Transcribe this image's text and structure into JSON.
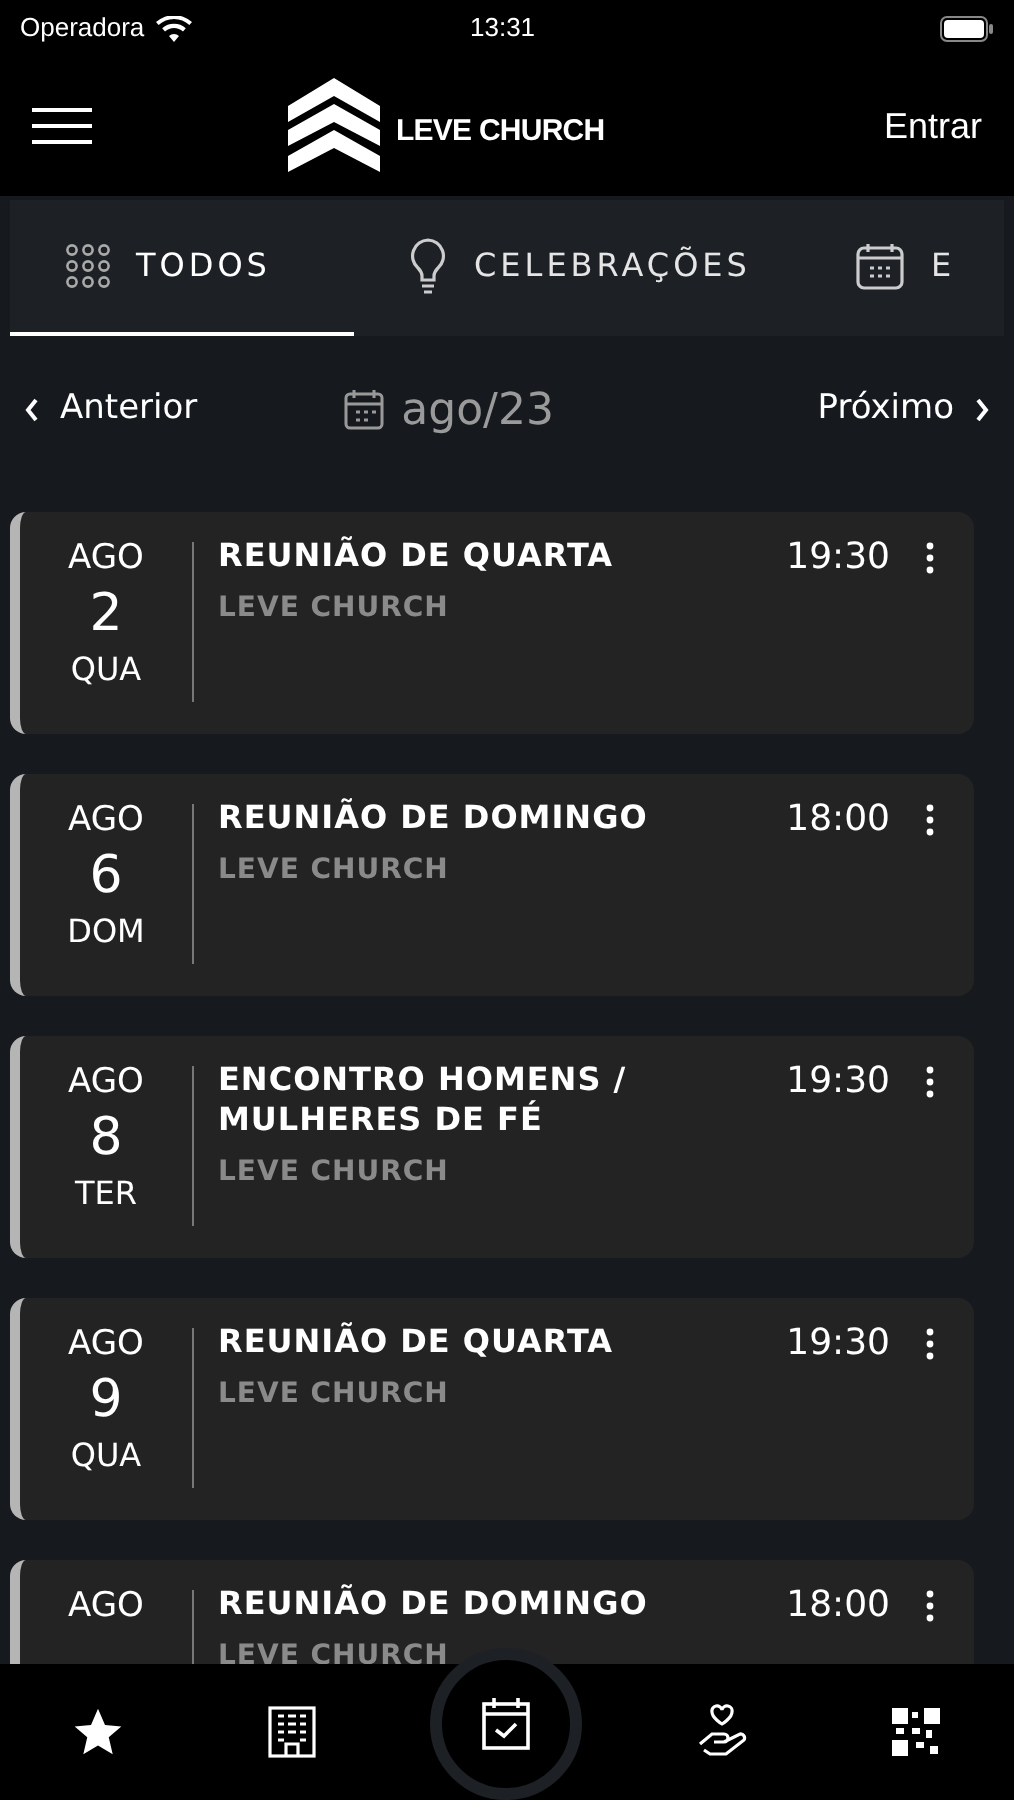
{
  "status_bar": {
    "carrier": "Operadora",
    "time": "13:31"
  },
  "header": {
    "logo_text": "LEVE CHURCH",
    "login": "Entrar"
  },
  "tabs": [
    {
      "label": "TODOS",
      "selected": true
    },
    {
      "label": "CELEBRAÇÕES",
      "selected": false
    },
    {
      "label": "E",
      "selected": false
    }
  ],
  "month_nav": {
    "previous": "Anterior",
    "month": "ago/23",
    "next": "Próximo"
  },
  "events": [
    {
      "month": "AGO",
      "day": "2",
      "weekday": "QUA",
      "title": "REUNIÃO DE QUARTA",
      "place": "LEVE CHURCH",
      "time": "19:30"
    },
    {
      "month": "AGO",
      "day": "6",
      "weekday": "DOM",
      "title": "REUNIÃO DE DOMINGO",
      "place": "LEVE CHURCH",
      "time": "18:00"
    },
    {
      "month": "AGO",
      "day": "8",
      "weekday": "TER",
      "title": "ENCONTRO HOMENS / MULHERES DE FÉ",
      "place": "LEVE CHURCH",
      "time": "19:30"
    },
    {
      "month": "AGO",
      "day": "9",
      "weekday": "QUA",
      "title": "REUNIÃO DE QUARTA",
      "place": "LEVE CHURCH",
      "time": "19:30"
    },
    {
      "month": "AGO",
      "title": "REUNIÃO DE DOMINGO",
      "place": "LEVE CHURCH",
      "time": "18:00"
    }
  ],
  "bottom_nav": [
    {
      "selected": false
    },
    {
      "selected": false
    },
    {
      "selected": true
    },
    {
      "selected": false
    },
    {
      "selected": false
    }
  ]
}
